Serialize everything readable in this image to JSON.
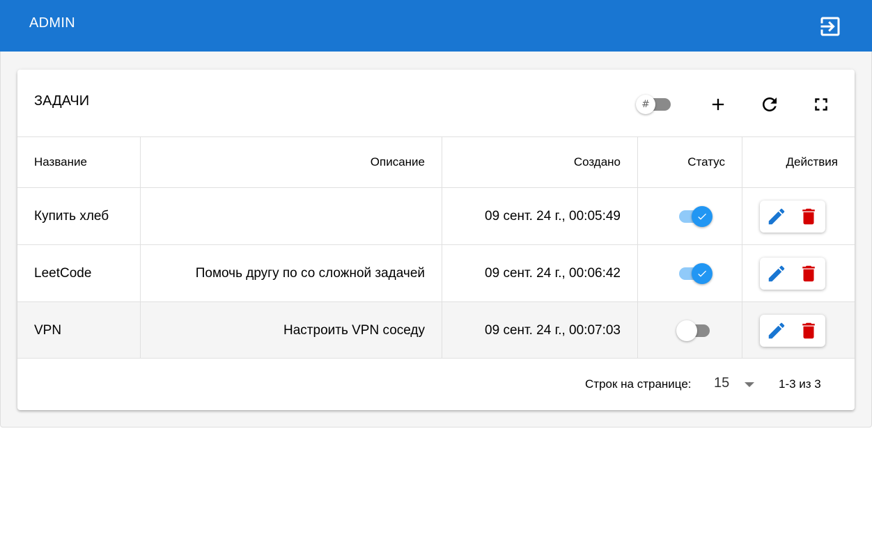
{
  "header": {
    "title": "ADMIN",
    "logout_icon": "logout-icon"
  },
  "card": {
    "title": "ЗАДАЧИ",
    "toolbar": {
      "toggle_symbol": "#",
      "toggle_state": "off",
      "add_icon": "plus-icon",
      "refresh_icon": "refresh-icon",
      "fullscreen_icon": "fullscreen-icon"
    }
  },
  "table": {
    "columns": [
      "Название",
      "Описание",
      "Создано",
      "Статус",
      "Действия"
    ],
    "rows": [
      {
        "name": "Купить хлеб",
        "description": "",
        "created": "09 сент. 24 г., 00:05:49",
        "status": true
      },
      {
        "name": "LeetCode",
        "description": "Помочь другу по со сложной задачей",
        "created": "09 сент. 24 г., 00:06:42",
        "status": true
      },
      {
        "name": "VPN",
        "description": "Настроить VPN соседу",
        "created": "09 сент. 24 г., 00:07:03",
        "status": false
      }
    ]
  },
  "pagination": {
    "rows_per_page_label": "Строк на странице:",
    "rows_per_page_value": "15",
    "range_text": "1-3 из 3"
  },
  "colors": {
    "primary": "#1976d2",
    "switch_on": "#2196f3",
    "edit_icon": "#1976d2",
    "delete_icon": "#d50000"
  }
}
